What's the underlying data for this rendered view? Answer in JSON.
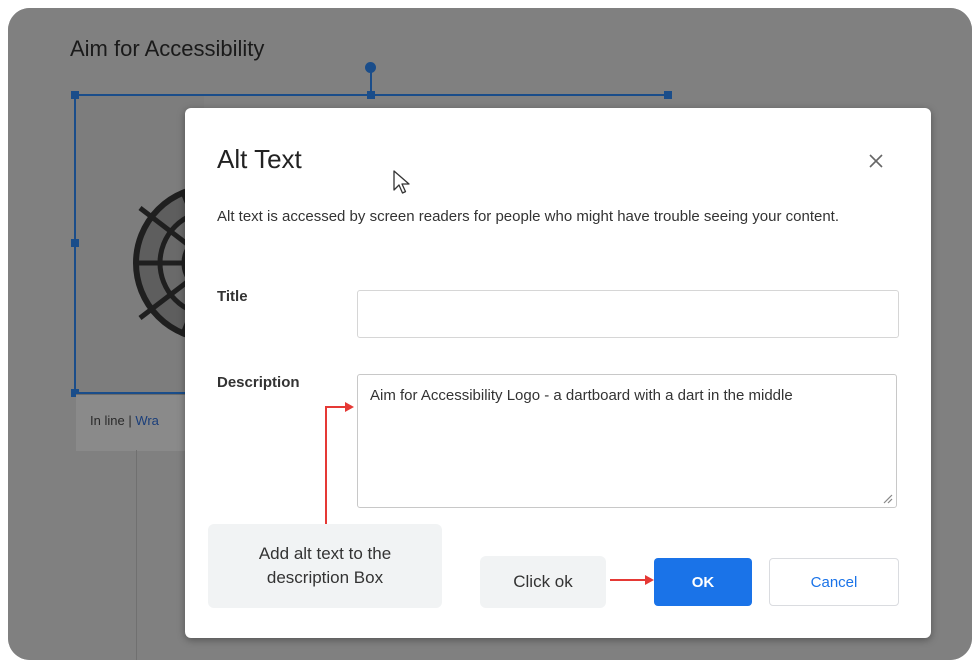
{
  "document": {
    "title": "Aim for Accessibility",
    "wrap_options": {
      "inline": "In line",
      "separator": " | ",
      "wrap": "Wra"
    }
  },
  "dialog": {
    "title": "Alt Text",
    "close_icon": "close-icon",
    "description": "Alt text is accessed by screen readers for people who might have trouble seeing your content.",
    "title_field": {
      "label": "Title",
      "value": ""
    },
    "description_field": {
      "label": "Description",
      "value": "Aim for Accessibility Logo - a dartboard with a dart in the middle"
    },
    "ok_label": "OK",
    "cancel_label": "Cancel",
    "accent_color": "#1a73e8"
  },
  "annotations": {
    "description_hint": "Add alt text to the description Box",
    "ok_hint": "Click ok",
    "arrow_color": "#e53935"
  }
}
